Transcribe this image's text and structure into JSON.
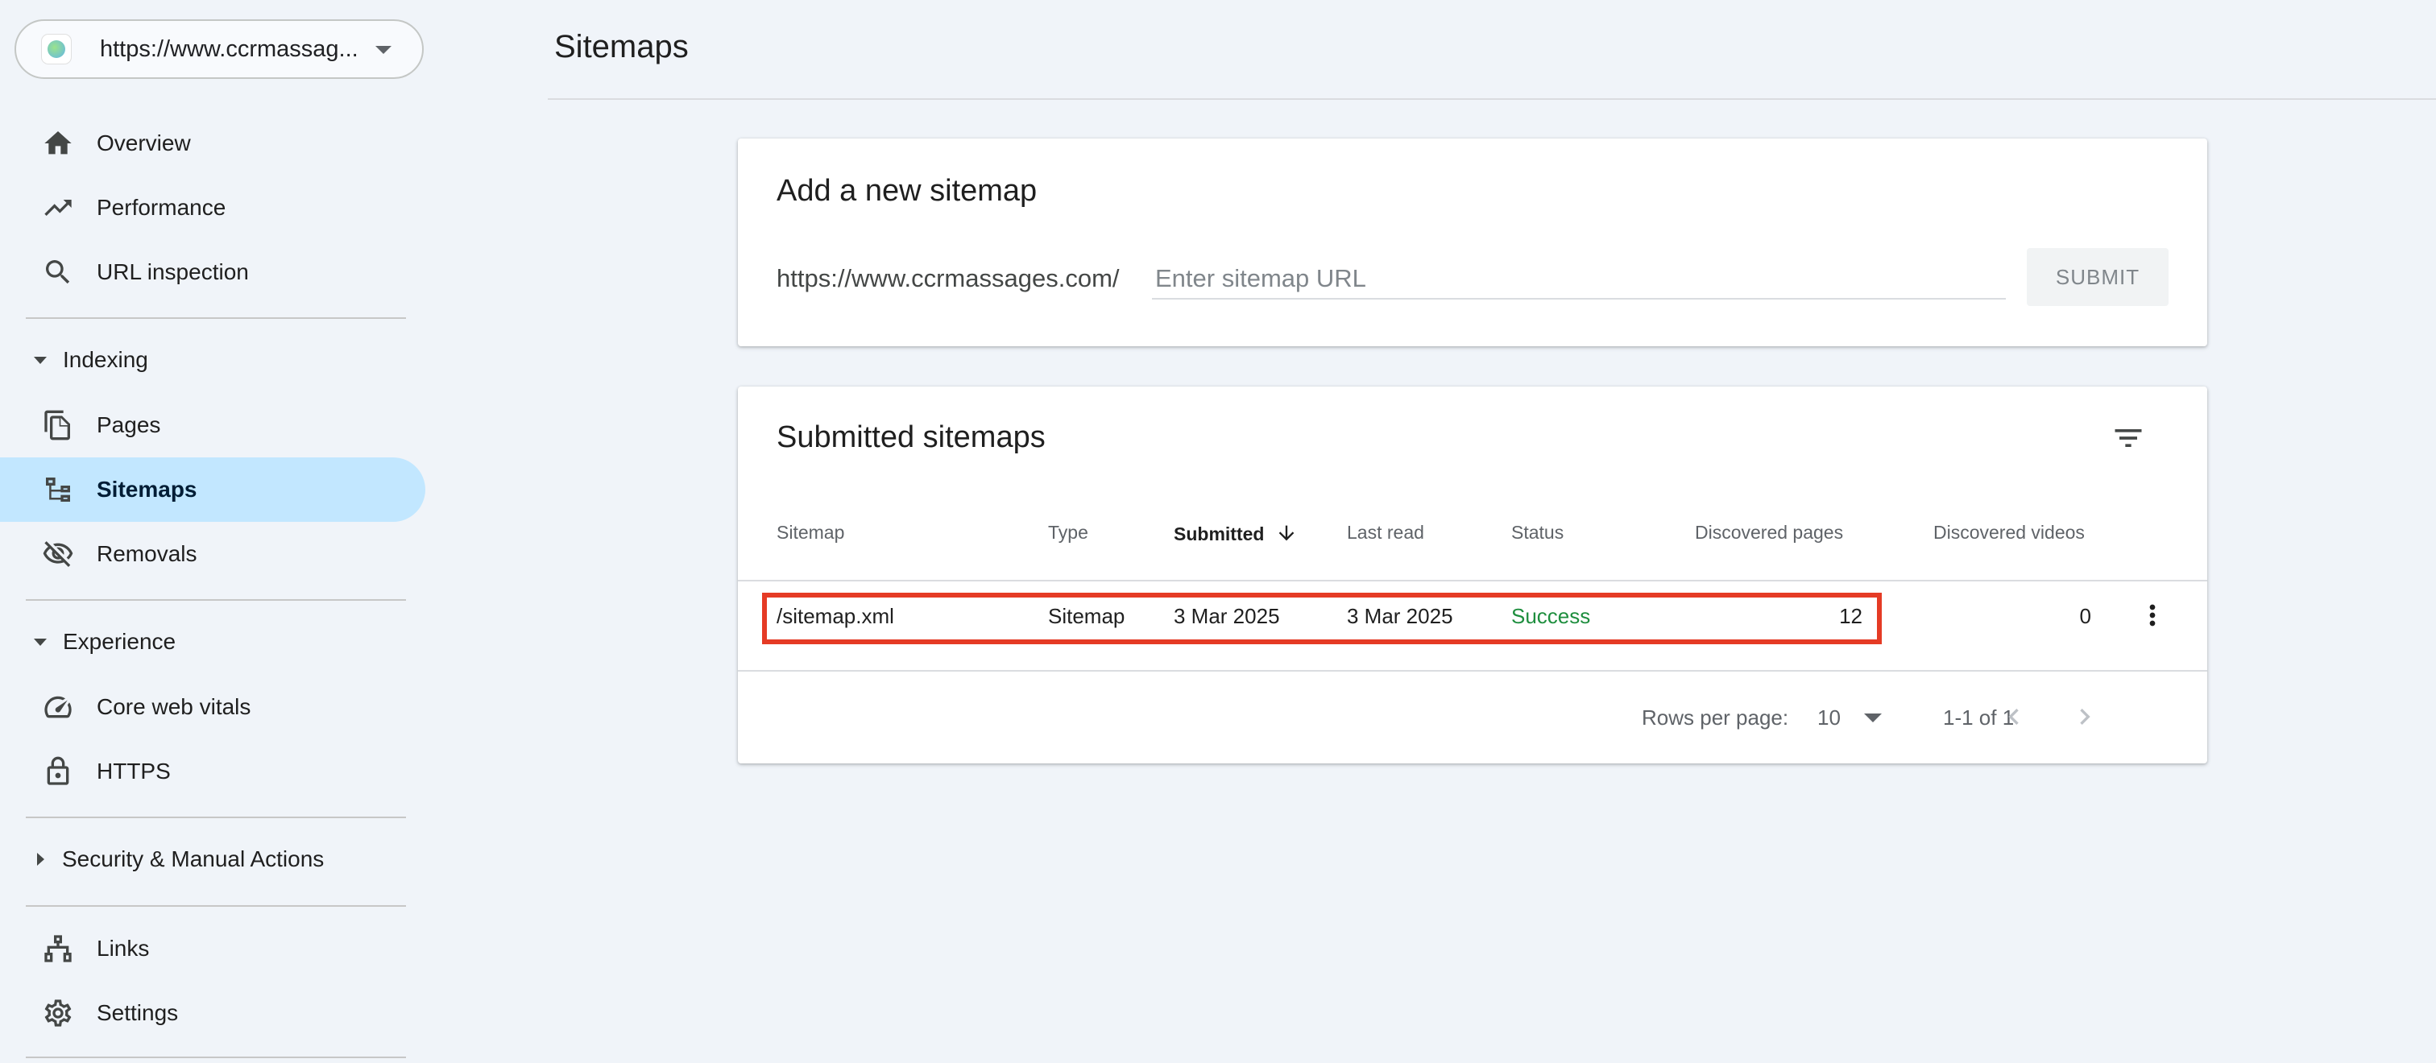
{
  "property": {
    "url": "https://www.ccrmassag..."
  },
  "sidebar": {
    "items_top": [
      {
        "label": "Overview",
        "icon": "home-icon"
      },
      {
        "label": "Performance",
        "icon": "trending-up-icon"
      },
      {
        "label": "URL inspection",
        "icon": "search-icon"
      }
    ],
    "sections": {
      "indexing": {
        "label": "Indexing",
        "expanded": true
      },
      "experience": {
        "label": "Experience",
        "expanded": true
      },
      "security": {
        "label": "Security & Manual Actions",
        "expanded": false
      }
    },
    "indexing_items": [
      {
        "label": "Pages",
        "icon": "pages-icon"
      },
      {
        "label": "Sitemaps",
        "icon": "sitemap-icon",
        "active": true
      },
      {
        "label": "Removals",
        "icon": "visibility-off-icon"
      }
    ],
    "experience_items": [
      {
        "label": "Core web vitals",
        "icon": "speed-gauge-icon"
      },
      {
        "label": "HTTPS",
        "icon": "lock-icon"
      }
    ],
    "bottom_items": [
      {
        "label": "Links",
        "icon": "links-icon"
      },
      {
        "label": "Settings",
        "icon": "gear-icon"
      }
    ]
  },
  "header": {
    "title": "Sitemaps"
  },
  "add_sitemap": {
    "title": "Add a new sitemap",
    "prefix": "https://www.ccrmassages.com/",
    "placeholder": "Enter sitemap URL",
    "submit_label": "SUBMIT"
  },
  "submitted": {
    "title": "Submitted sitemaps",
    "columns": {
      "sitemap": "Sitemap",
      "type": "Type",
      "submitted": "Submitted",
      "last_read": "Last read",
      "status": "Status",
      "discovered_pages": "Discovered pages",
      "discovered_videos": "Discovered videos"
    },
    "rows": [
      {
        "sitemap": "/sitemap.xml",
        "type": "Sitemap",
        "submitted": "3 Mar 2025",
        "last_read": "3 Mar 2025",
        "status": "Success",
        "discovered_pages": "12",
        "discovered_videos": "0"
      }
    ],
    "pagination": {
      "rows_per_page_label": "Rows per page:",
      "rows_per_page": "10",
      "range": "1-1 of 1"
    }
  },
  "colors": {
    "active_nav": "#c2e7ff",
    "success": "#1e8e3e",
    "highlight_border": "#e53b25",
    "background": "#f0f4f9"
  }
}
